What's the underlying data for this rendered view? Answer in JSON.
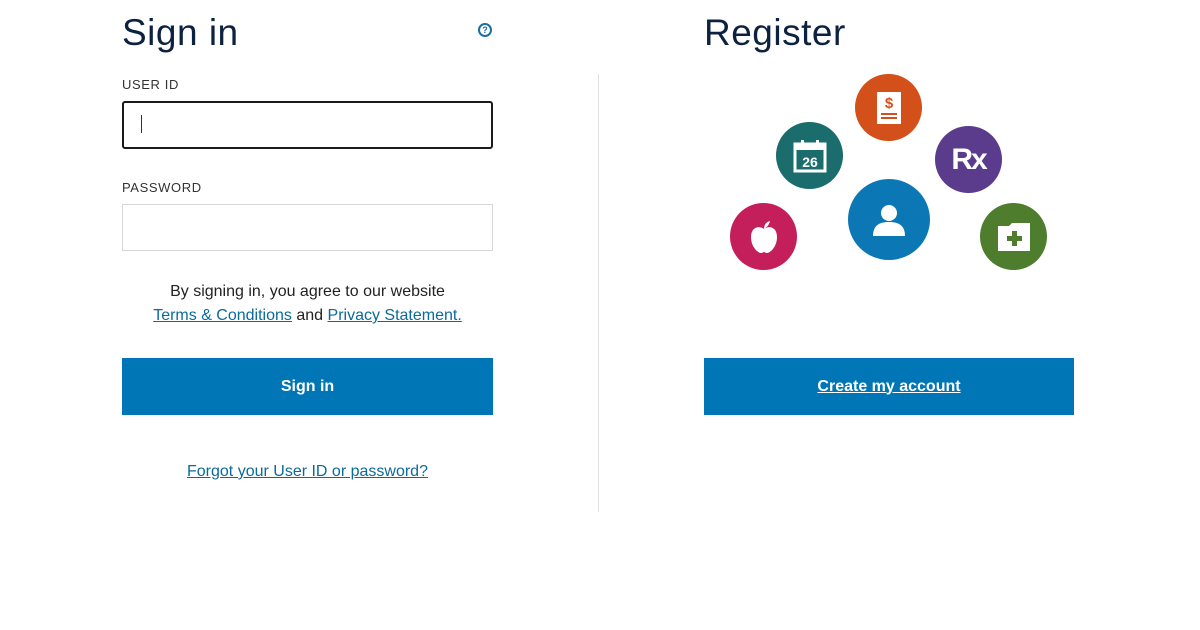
{
  "signin": {
    "title": "Sign in",
    "help_icon": "question-circle-icon",
    "user_id_label": "USER ID",
    "user_id_value": "",
    "password_label": "PASSWORD",
    "password_value": "",
    "terms_text": "By signing in, you agree to our website",
    "terms_link": "Terms & Conditions",
    "and_text": "and",
    "privacy_link": "Privacy Statement.",
    "button_label": "Sign in",
    "forgot_link": "Forgot your User ID or password?"
  },
  "register": {
    "title": "Register",
    "button_label": "Create my account",
    "icons": [
      {
        "name": "bill-icon",
        "color": "#d4501a"
      },
      {
        "name": "calendar-icon",
        "color": "#1b6c6c",
        "text": "26"
      },
      {
        "name": "rx-icon",
        "color": "#5b3b8c",
        "text": "Rx"
      },
      {
        "name": "person-icon",
        "color": "#0b78b5"
      },
      {
        "name": "apple-icon",
        "color": "#c41f5a"
      },
      {
        "name": "medical-folder-icon",
        "color": "#4e7d2d"
      }
    ]
  },
  "colors": {
    "primary_button": "#0076b6",
    "link": "#0a6a9a",
    "heading": "#0d2240"
  }
}
